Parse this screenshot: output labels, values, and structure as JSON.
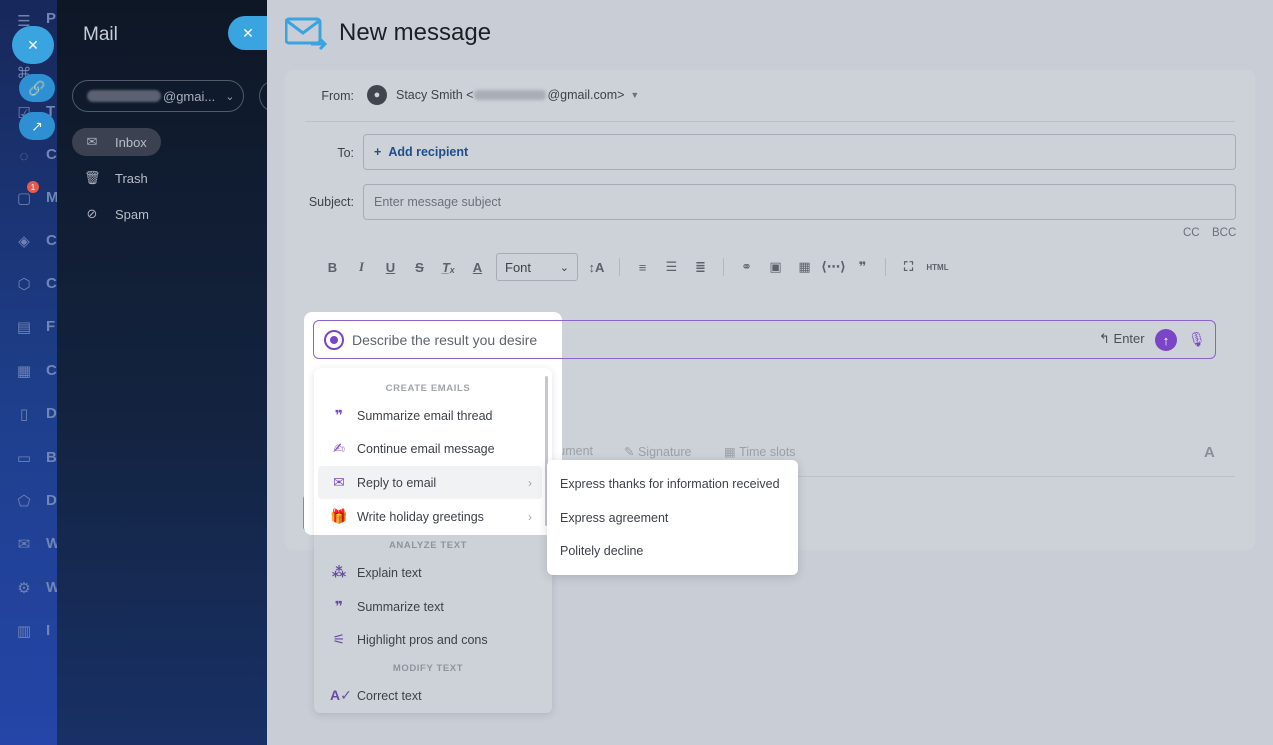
{
  "app_rail": {
    "letters": [
      "P",
      "T",
      "C",
      "M",
      "C",
      "C",
      "F",
      "C",
      "D",
      "B",
      "D",
      "W",
      "W",
      "I"
    ],
    "badge": "1"
  },
  "mail": {
    "title": "Mail",
    "account_suffix": "@gmai...",
    "folders": [
      {
        "label": "Inbox",
        "icon": "inbox-icon"
      },
      {
        "label": "Trash",
        "icon": "trash-icon"
      },
      {
        "label": "Spam",
        "icon": "spam-icon"
      }
    ]
  },
  "compose": {
    "title": "New message",
    "from_label": "From:",
    "from_name": "Stacy Smith <",
    "from_domain": "@gmail.com>",
    "to_label": "To:",
    "add_recipient": "Add recipient",
    "subject_label": "Subject:",
    "subject_placeholder": "Enter message subject",
    "cc": "CC",
    "bcc": "BCC",
    "font_select": "Font",
    "html_label": "HTML"
  },
  "faded": {
    "document": "cument",
    "signature": "Signature",
    "time_slots": "Time slots",
    "letter": "A"
  },
  "ai": {
    "placeholder": "Describe the result you desire",
    "enter_hint": "Enter",
    "accent": "#7b45c8"
  },
  "menu": {
    "sections": [
      {
        "title": "CREATE EMAILS"
      },
      {
        "title": "ANALYZE TEXT"
      },
      {
        "title": "MODIFY TEXT"
      }
    ],
    "items": [
      {
        "label": "Summarize email thread",
        "icon": "quote-icon"
      },
      {
        "label": "Continue email message",
        "icon": "pen-icon"
      },
      {
        "label": "Reply to email",
        "icon": "reply-icon"
      },
      {
        "label": "Write holiday greetings",
        "icon": "gift-icon"
      },
      {
        "label": "Explain text",
        "icon": "cursor-click-icon"
      },
      {
        "label": "Summarize text",
        "icon": "quote-icon"
      },
      {
        "label": "Highlight pros and cons",
        "icon": "sliders-icon"
      },
      {
        "label": "Correct text",
        "icon": "spellcheck-icon"
      }
    ],
    "submenu": [
      {
        "label": "Express thanks for information received"
      },
      {
        "label": "Express agreement"
      },
      {
        "label": "Politely decline"
      }
    ]
  }
}
